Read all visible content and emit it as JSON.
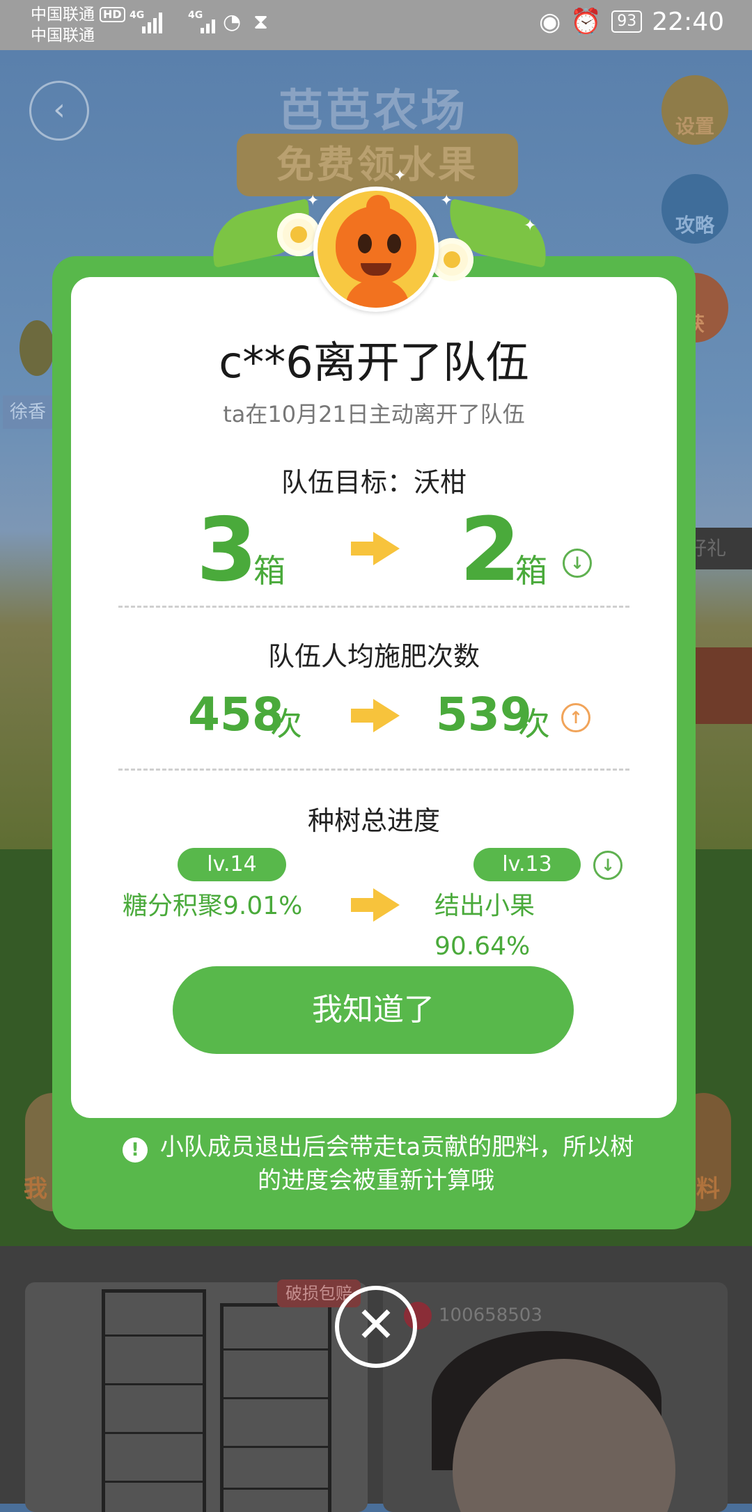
{
  "status_bar": {
    "carrier_1": "中国联通",
    "carrier_2": "中国联通",
    "hd_badge": "HD",
    "network_1": "4G",
    "network_2": "4G",
    "battery": "93",
    "time": "22:40"
  },
  "background": {
    "game_title": "芭芭农场",
    "banner": "免费领水果",
    "settings_label": "设置",
    "guide_label": "攻略",
    "harvest_label": "获",
    "friend_name": "徐香",
    "gift_label": "好礼",
    "left_bottom_label": "我",
    "right_bottom_label": "料",
    "product_tag": "破损包赔",
    "product_follow_count": "100658503"
  },
  "modal": {
    "title": "c**6离开了队伍",
    "subtitle": "ta在10月21日主动离开了队伍",
    "goal": {
      "label": "队伍目标：沃柑",
      "from_value": "3",
      "to_value": "2",
      "unit": "箱",
      "trend": "down"
    },
    "fertilize": {
      "label": "队伍人均施肥次数",
      "from_value": "458",
      "to_value": "539",
      "unit": "次",
      "trend": "up"
    },
    "progress": {
      "label": "种树总进度",
      "from_level": "lv.14",
      "to_level": "lv.13",
      "from_stage": "糖分积聚9.01%",
      "to_stage_name": "结出小果",
      "to_stage_percent": "90.64%",
      "trend": "down"
    },
    "confirm_button": "我知道了",
    "note": "小队成员退出后会带走ta贡献的肥料，所以树的进度会被重新计算哦",
    "note_icon": "!"
  },
  "colors": {
    "accent_green": "#58b84b",
    "value_green": "#4aaa3b",
    "arrow_yellow": "#f7c33c",
    "up_orange": "#f1a45a"
  }
}
